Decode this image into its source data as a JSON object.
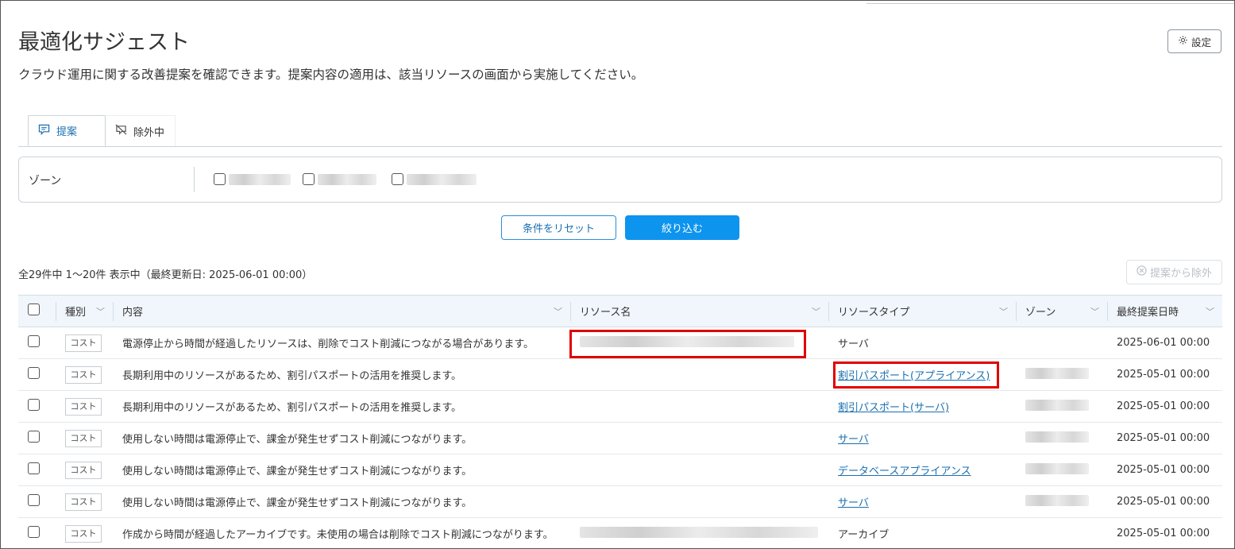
{
  "page": {
    "title": "最適化サジェスト",
    "description": "クラウド運用に関する改善提案を確認できます。提案内容の適用は、該当リソースの画面から実施してください。",
    "settings_label": "設定"
  },
  "tabs": [
    {
      "label": "提案",
      "icon": "comment-icon",
      "active": true
    },
    {
      "label": "除外中",
      "icon": "eye-off-icon",
      "active": false
    }
  ],
  "filter": {
    "zone_label": "ゾーン",
    "reset_label": "条件をリセット",
    "apply_label": "絞り込む"
  },
  "summary": {
    "count_text": "全29件中 1～20件 表示中（最終更新日: 2025-06-01 00:00）",
    "exclude_label": "提案から除外"
  },
  "table": {
    "columns": [
      "種別",
      "内容",
      "リソース名",
      "リソースタイプ",
      "ゾーン",
      "最終提案日時"
    ],
    "rows": [
      {
        "type": "コスト",
        "content": "電源停止から時間が経過したリソースは、削除でコスト削減につながる場合があります。",
        "resource_type": "サーバ",
        "resource_type_link": false,
        "date": "2025-06-01 00:00"
      },
      {
        "type": "コスト",
        "content": "長期利用中のリソースがあるため、割引パスポートの活用を推奨します。",
        "resource_type": "割引パスポート(アプライアンス)",
        "resource_type_link": true,
        "date": "2025-05-01 00:00"
      },
      {
        "type": "コスト",
        "content": "長期利用中のリソースがあるため、割引パスポートの活用を推奨します。",
        "resource_type": "割引パスポート(サーバ)",
        "resource_type_link": true,
        "date": "2025-05-01 00:00"
      },
      {
        "type": "コスト",
        "content": "使用しない時間は電源停止で、課金が発生せずコスト削減につながります。",
        "resource_type": "サーバ",
        "resource_type_link": true,
        "date": "2025-05-01 00:00"
      },
      {
        "type": "コスト",
        "content": "使用しない時間は電源停止で、課金が発生せずコスト削減につながります。",
        "resource_type": "データベースアプライアンス",
        "resource_type_link": true,
        "date": "2025-05-01 00:00"
      },
      {
        "type": "コスト",
        "content": "使用しない時間は電源停止で、課金が発生せずコスト削減につながります。",
        "resource_type": "サーバ",
        "resource_type_link": true,
        "date": "2025-05-01 00:00"
      },
      {
        "type": "コスト",
        "content": "作成から時間が経過したアーカイブです。未使用の場合は削除でコスト削減につながります。",
        "resource_type": "アーカイブ",
        "resource_type_link": false,
        "date": "2025-05-01 00:00"
      }
    ]
  },
  "colors": {
    "accent": "#0d94ee",
    "link": "#1a6fb0",
    "highlight": "#e00000"
  }
}
